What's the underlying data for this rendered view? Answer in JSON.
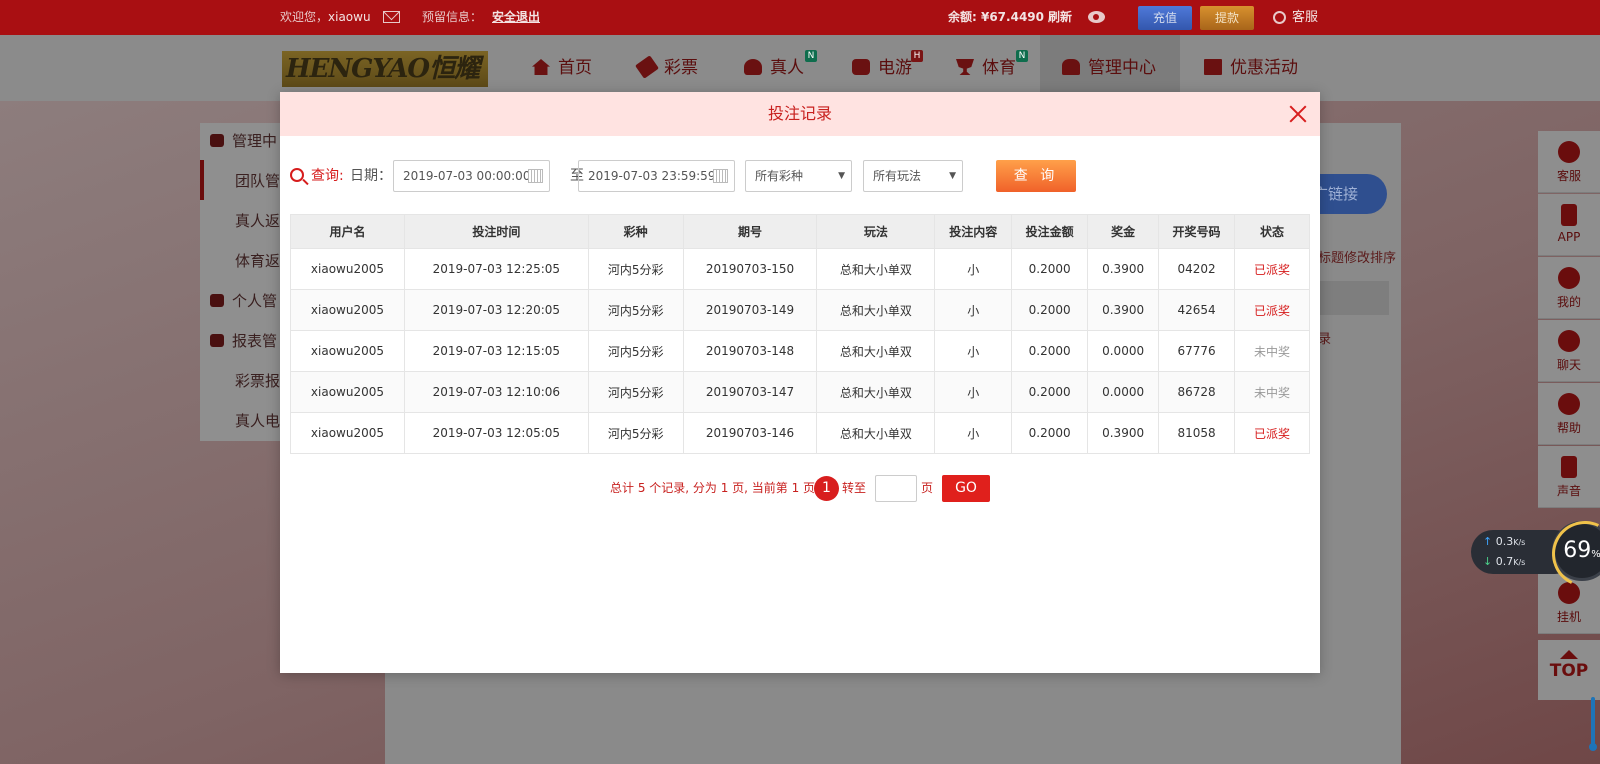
{
  "topbar": {
    "welcome": "欢迎您，",
    "username": "xiaowu",
    "preset_info": "预留信息：",
    "logout": "安全退出",
    "balance_label": "余额: ",
    "balance": "¥67.4490",
    "refresh": "刷新",
    "charge": "充值",
    "withdraw": "提款",
    "service": "客服"
  },
  "logo": {
    "text": "HENGYAO恒耀"
  },
  "nav": [
    {
      "label": "首页",
      "icon": "home-icon"
    },
    {
      "label": "彩票",
      "icon": "ticket-icon"
    },
    {
      "label": "真人",
      "icon": "live-dealer-icon",
      "badge": "N"
    },
    {
      "label": "电游",
      "icon": "slot-machine-icon",
      "badge": "H"
    },
    {
      "label": "体育",
      "icon": "trophy-icon",
      "badge": "N"
    },
    {
      "label": "管理中心",
      "icon": "users-icon"
    },
    {
      "label": "优惠活动",
      "icon": "gift-icon"
    }
  ],
  "sidebar": [
    {
      "label": "管理中"
    },
    {
      "label": "团队管"
    },
    {
      "label": "真人返"
    },
    {
      "label": "体育返"
    },
    {
      "label": "个人管"
    },
    {
      "label": "报表管"
    },
    {
      "label": "彩票报"
    },
    {
      "label": "真人电"
    }
  ],
  "background": {
    "promo_link": "广链接",
    "sort_hint": "标题修改排序",
    "record_text": "录"
  },
  "right_toolbar": [
    {
      "label": "客服",
      "icon": "customer-service-icon"
    },
    {
      "label": "APP",
      "icon": "mobile-icon"
    },
    {
      "label": "我的",
      "icon": "user-icon"
    },
    {
      "label": "聊天",
      "icon": "chat-icon"
    },
    {
      "label": "帮助",
      "icon": "help-icon"
    },
    {
      "label": "声音",
      "icon": "speaker-icon"
    },
    {
      "label": "挂机",
      "icon": "bag-icon"
    }
  ],
  "top_button": "TOP",
  "speed_widget": {
    "up": "0.3",
    "down": "0.7",
    "unit": "K/s",
    "percent": "69",
    "percent_sign": "%"
  },
  "modal": {
    "title": "投注记录",
    "filter": {
      "query_label": "查询:",
      "date_label": "日期：",
      "start": "2019-07-03 00:00:00",
      "to": "至",
      "end": "2019-07-03 23:59:59",
      "lottery_select": "所有彩种",
      "play_select": "所有玩法",
      "query_button": "查 询"
    },
    "table": {
      "headers": [
        "用户名",
        "投注时间",
        "彩种",
        "期号",
        "玩法",
        "投注内容",
        "投注金额",
        "奖金",
        "开奖号码",
        "状态"
      ],
      "rows": [
        [
          "xiaowu2005",
          "2019-07-03 12:25:05",
          "河内5分彩",
          "20190703-150",
          "总和大小单双",
          "小",
          "0.2000",
          "0.3900",
          "04202",
          "已派奖"
        ],
        [
          "xiaowu2005",
          "2019-07-03 12:20:05",
          "河内5分彩",
          "20190703-149",
          "总和大小单双",
          "小",
          "0.2000",
          "0.3900",
          "42654",
          "已派奖"
        ],
        [
          "xiaowu2005",
          "2019-07-03 12:15:05",
          "河内5分彩",
          "20190703-148",
          "总和大小单双",
          "小",
          "0.2000",
          "0.0000",
          "67776",
          "未中奖"
        ],
        [
          "xiaowu2005",
          "2019-07-03 12:10:06",
          "河内5分彩",
          "20190703-147",
          "总和大小单双",
          "小",
          "0.2000",
          "0.0000",
          "86728",
          "未中奖"
        ],
        [
          "xiaowu2005",
          "2019-07-03 12:05:05",
          "河内5分彩",
          "20190703-146",
          "总和大小单双",
          "小",
          "0.2000",
          "0.3900",
          "81058",
          "已派奖"
        ]
      ]
    },
    "pager": {
      "summary": "总计 5 个记录, 分为 1 页, 当前第 1 页",
      "current": "1",
      "goto": "转至",
      "page_unit": "页",
      "go": "GO"
    }
  }
}
